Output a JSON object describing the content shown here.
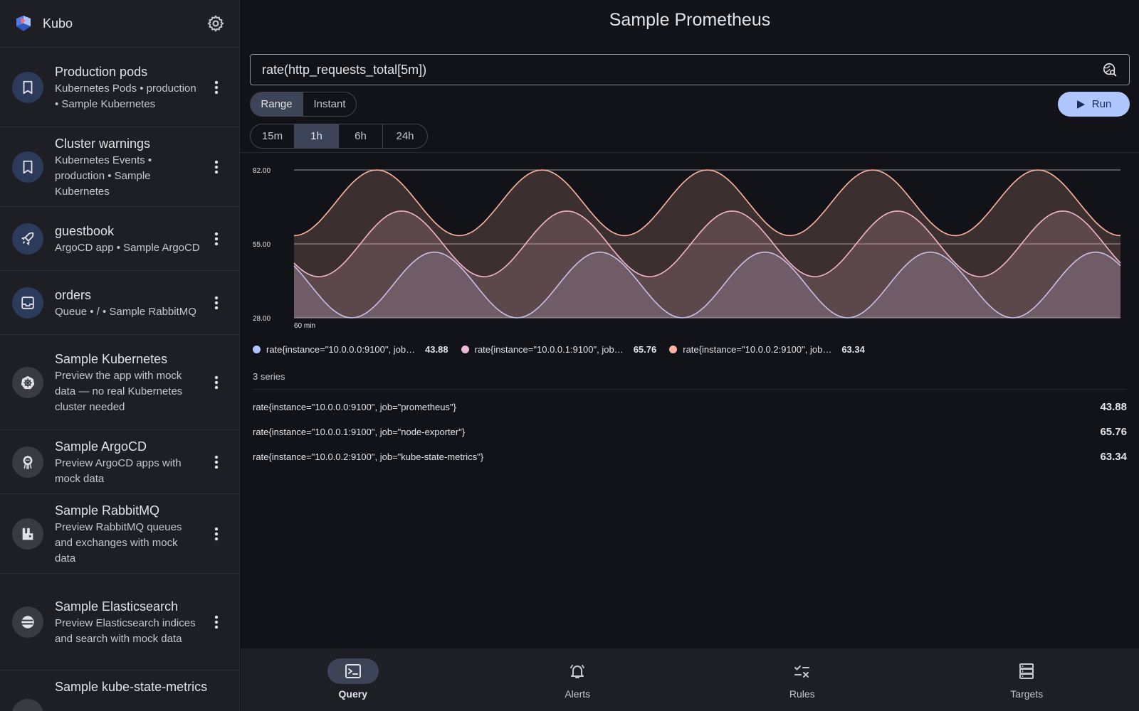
{
  "app": {
    "name": "Kubo"
  },
  "sidebar": {
    "items": [
      {
        "title": "Production pods",
        "subtitle": "Kubernetes Pods • production • Sample Kubernetes",
        "icon": "bookmark-icon"
      },
      {
        "title": "Cluster warnings",
        "subtitle": "Kubernetes Events • production • Sample Kubernetes",
        "icon": "bookmark-icon"
      },
      {
        "title": "guestbook",
        "subtitle": "ArgoCD app • Sample ArgoCD",
        "icon": "rocket-icon"
      },
      {
        "title": "orders",
        "subtitle": "Queue • / • Sample RabbitMQ",
        "icon": "inbox-icon"
      },
      {
        "title": "Sample Kubernetes",
        "subtitle": "Preview the app with mock data — no real Kubernetes cluster needed",
        "icon": "kubernetes-helm-icon"
      },
      {
        "title": "Sample ArgoCD",
        "subtitle": "Preview ArgoCD apps with mock data",
        "icon": "argocd-octopus-icon"
      },
      {
        "title": "Sample RabbitMQ",
        "subtitle": "Preview RabbitMQ queues and exchanges with mock data",
        "icon": "rabbitmq-icon"
      },
      {
        "title": "Sample Elasticsearch",
        "subtitle": "Preview Elasticsearch indices and search with mock data",
        "icon": "elasticsearch-icon"
      },
      {
        "title": "Sample kube-state-metrics",
        "subtitle": "",
        "icon": "metrics-icon"
      }
    ]
  },
  "header": {
    "title": "Sample Prometheus"
  },
  "query": {
    "value": "rate(http_requests_total[5m])"
  },
  "mode": {
    "options": [
      "Range",
      "Instant"
    ],
    "selected": "Range"
  },
  "range": {
    "options": [
      "15m",
      "1h",
      "6h",
      "24h"
    ],
    "selected": "1h"
  },
  "run": {
    "label": "Run"
  },
  "chart_data": {
    "type": "area",
    "x_label_start": "60 min",
    "y_ticks": [
      "82.00",
      "55.00",
      "28.00"
    ],
    "ylim": [
      28,
      82
    ],
    "grid": true,
    "legend_placement": "bottom",
    "series": [
      {
        "name": "rate{instance=\"10.0.0.0:9100\", job=\"prometheus\"}",
        "short": "rate{instance=\"10.0.0.0:9100\", job…",
        "current": "43.88",
        "color": "#b3c5ff",
        "min": 28,
        "max": 52,
        "period_min": 12,
        "phase_start": 47
      },
      {
        "name": "rate{instance=\"10.0.0.1:9100\", job=\"node-exporter\"}",
        "short": "rate{instance=\"10.0.0.1:9100\", job…",
        "current": "65.76",
        "color": "#f0b8d4",
        "min": 43,
        "max": 67,
        "period_min": 12,
        "phase_start": 48
      },
      {
        "name": "rate{instance=\"10.0.0.2:9100\", job=\"kube-state-metrics\"}",
        "short": "rate{instance=\"10.0.0.2:9100\", job…",
        "current": "63.34",
        "color": "#ffb3a0",
        "min": 58,
        "max": 82,
        "period_min": 12,
        "phase_start": 58
      }
    ]
  },
  "series_list": {
    "count_label": "3 series"
  },
  "bottom_nav": {
    "items": [
      {
        "label": "Query",
        "icon": "terminal-icon",
        "active": true
      },
      {
        "label": "Alerts",
        "icon": "bell-icon",
        "active": false
      },
      {
        "label": "Rules",
        "icon": "rules-icon",
        "active": false
      },
      {
        "label": "Targets",
        "icon": "storage-icon",
        "active": false
      }
    ]
  },
  "colors": {
    "accent": "#b0c6ff",
    "background": "#121318",
    "surface": "#1e1f25"
  }
}
